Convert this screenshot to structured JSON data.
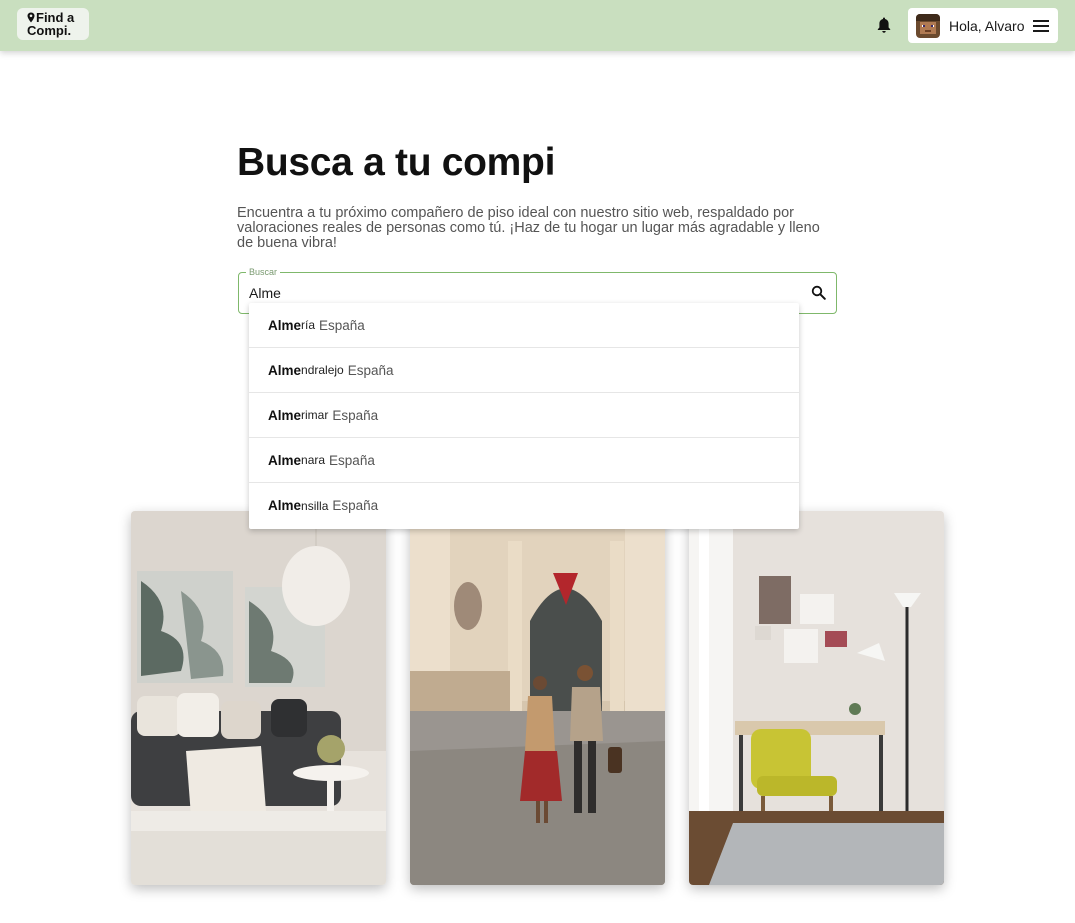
{
  "header": {
    "logo_line1": "Find a",
    "logo_line2": "Compi.",
    "notifications_icon": "bell-icon",
    "user_greeting": "Hola, Alvaro",
    "menu_icon": "hamburger-menu-icon",
    "background_color": "#c9dfbf"
  },
  "hero": {
    "title": "Busca a tu compi",
    "subtitle": "Encuentra a tu próximo compañero de piso ideal con nuestro sitio web, respaldado por valoraciones reales de personas como tú. ¡Haz de tu hogar un lugar más agradable y lleno de buena vibra!"
  },
  "search": {
    "label": "Buscar",
    "value": "Alme",
    "icon": "search-icon",
    "suggestions": [
      {
        "match": "Alme",
        "rest": "ría",
        "country": "España"
      },
      {
        "match": "Alme",
        "rest": "ndralejo",
        "country": "España"
      },
      {
        "match": "Alme",
        "rest": "rimar",
        "country": "España"
      },
      {
        "match": "Alme",
        "rest": "nara",
        "country": "España"
      },
      {
        "match": "Alme",
        "rest": "nsilla",
        "country": "España"
      }
    ]
  },
  "photos": [
    {
      "subject": "living-room-photo"
    },
    {
      "subject": "couple-walking-street-photo"
    },
    {
      "subject": "desk-chair-room-photo"
    }
  ]
}
